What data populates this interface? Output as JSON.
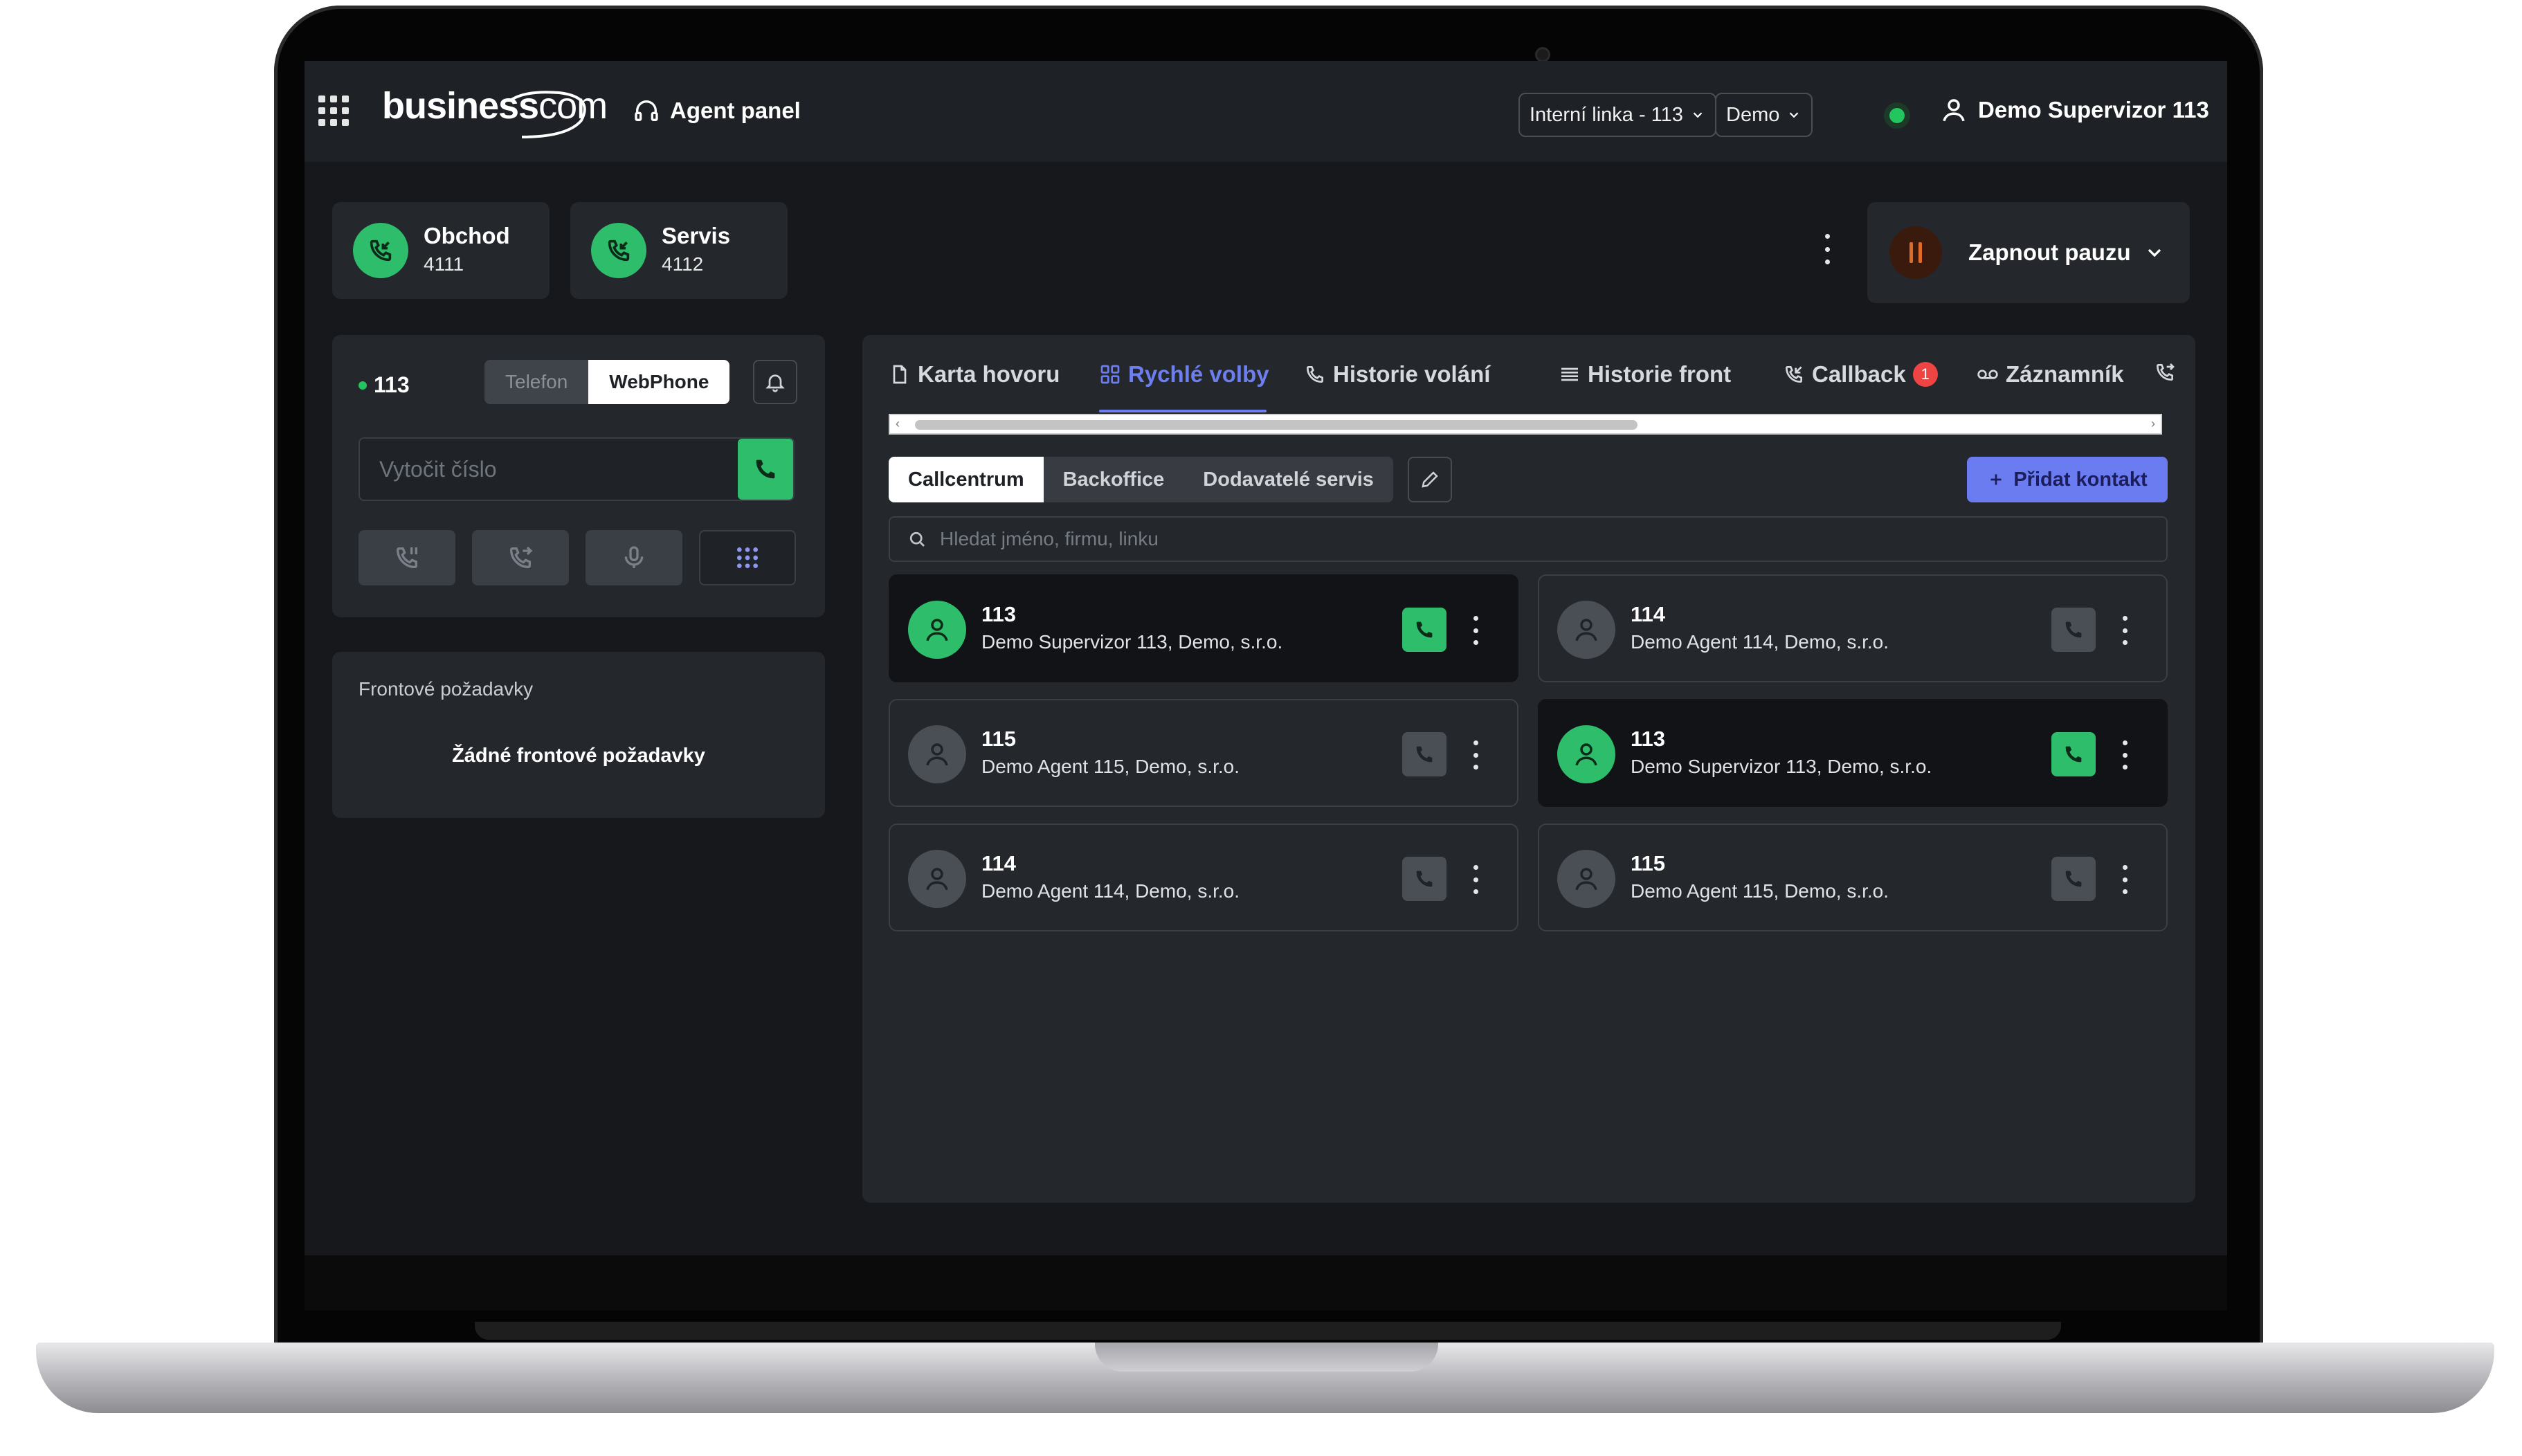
{
  "header": {
    "logo_main": "business",
    "logo_suffix": "com",
    "app_title": "Agent panel",
    "line_select": "Interní linka - 113",
    "company_select": "Demo",
    "user_name": "Demo Supervizor 113"
  },
  "queues": [
    {
      "name": "Obchod",
      "number": "4111"
    },
    {
      "name": "Servis",
      "number": "4112"
    }
  ],
  "pause": {
    "label": "Zapnout pauzu",
    "accent": "#e06a28"
  },
  "phone": {
    "extension": "113",
    "mode_options": [
      "Telefon",
      "WebPhone"
    ],
    "mode_selected": "WebPhone",
    "dial_placeholder": "Vytočit číslo"
  },
  "queue_requests": {
    "title": "Frontové požadavky",
    "empty_text": "Žádné frontové požadavky"
  },
  "tabs": {
    "items": [
      "Karta hovoru",
      "Rychlé volby",
      "Historie volání",
      "Historie front",
      "Callback",
      "Záznamník"
    ],
    "active": "Rychlé volby",
    "callback_badge": "1"
  },
  "speed_dial": {
    "groups": [
      "Callcentrum",
      "Backoffice",
      "Dodavatelé servis"
    ],
    "active_group": "Callcentrum",
    "add_contact_label": "Přidat kontakt",
    "search_placeholder": "Hledat jméno, firmu, linku",
    "contacts": [
      {
        "ext": "113",
        "name": "Demo Supervizor 113, Demo, s.r.o.",
        "active": true
      },
      {
        "ext": "114",
        "name": "Demo Agent 114, Demo, s.r.o.",
        "active": false
      },
      {
        "ext": "115",
        "name": "Demo Agent 115, Demo, s.r.o.",
        "active": false
      },
      {
        "ext": "113",
        "name": "Demo Supervizor 113, Demo, s.r.o.",
        "active": true
      },
      {
        "ext": "114",
        "name": "Demo Agent 114, Demo, s.r.o.",
        "active": false
      },
      {
        "ext": "115",
        "name": "Demo Agent 115, Demo, s.r.o.",
        "active": false
      }
    ]
  },
  "colors": {
    "accent": "#6a7cf0",
    "online": "#22c55e",
    "call_green": "#2ebd6b",
    "background": "#16181b",
    "panel": "#24272c"
  }
}
